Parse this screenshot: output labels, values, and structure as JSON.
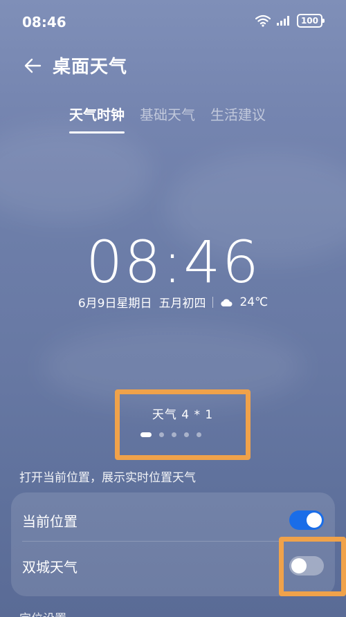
{
  "status_bar": {
    "time": "08:46",
    "battery": "100"
  },
  "header": {
    "title": "桌面天气"
  },
  "tabs": [
    {
      "label": "天气时钟",
      "active": true
    },
    {
      "label": "基础天气",
      "active": false
    },
    {
      "label": "生活建议",
      "active": false
    }
  ],
  "preview": {
    "time": "08:46",
    "date": "6月9日星期日",
    "lunar": "五月初四",
    "temperature": "24℃"
  },
  "widget": {
    "label": "天气 4 * 1",
    "page_count": 5,
    "active_page": 1
  },
  "settings": {
    "hint": "打开当前位置，展示实时位置天气",
    "items": [
      {
        "label": "当前位置",
        "enabled": true
      },
      {
        "label": "双城天气",
        "enabled": false
      }
    ],
    "footer_label": "定位设置"
  },
  "colors": {
    "accent": "#1a6de8",
    "highlight": "#f0a24a"
  }
}
